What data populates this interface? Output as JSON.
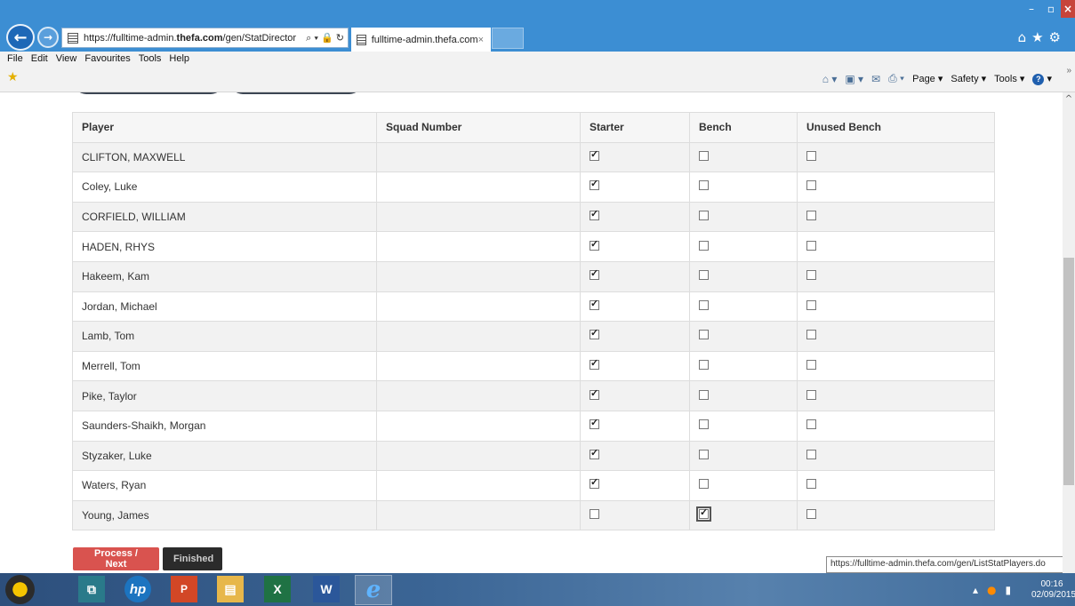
{
  "browser": {
    "address_url_prefix": "https://fulltime-admin.",
    "address_url_domain": "thefa.com",
    "address_url_suffix": "/gen/StatDirector",
    "address_icons": "⌕ ▾ 🔒 ↻",
    "tab_title": "fulltime-admin.thefa.com",
    "tab_close": "×",
    "window_controls": {
      "minimize": "–",
      "maximize": "▫",
      "close": "×"
    },
    "toolbar_icons": [
      "home-icon",
      "star-icon",
      "gear-icon"
    ]
  },
  "menubar": {
    "items": [
      "File",
      "Edit",
      "View",
      "Favourites",
      "Tools",
      "Help"
    ]
  },
  "commandbar": {
    "page_label": "Page ▾",
    "safety_label": "Safety ▾",
    "tools_label": "Tools ▾",
    "more": "»"
  },
  "table": {
    "headers": [
      "Player",
      "Squad Number",
      "Starter",
      "Bench",
      "Unused Bench"
    ],
    "rows": [
      {
        "player": "CLIFTON, MAXWELL",
        "squad": "",
        "starter": true,
        "bench": false,
        "unused": false
      },
      {
        "player": "Coley, Luke",
        "squad": "",
        "starter": true,
        "bench": false,
        "unused": false
      },
      {
        "player": "CORFIELD, WILLIAM",
        "squad": "",
        "starter": true,
        "bench": false,
        "unused": false
      },
      {
        "player": "HADEN, RHYS",
        "squad": "",
        "starter": true,
        "bench": false,
        "unused": false
      },
      {
        "player": "Hakeem, Kam",
        "squad": "",
        "starter": true,
        "bench": false,
        "unused": false
      },
      {
        "player": "Jordan, Michael",
        "squad": "",
        "starter": true,
        "bench": false,
        "unused": false
      },
      {
        "player": "Lamb, Tom",
        "squad": "",
        "starter": true,
        "bench": false,
        "unused": false
      },
      {
        "player": "Merrell, Tom",
        "squad": "",
        "starter": true,
        "bench": false,
        "unused": false
      },
      {
        "player": "Pike, Taylor",
        "squad": "",
        "starter": true,
        "bench": false,
        "unused": false
      },
      {
        "player": "Saunders-Shaikh, Morgan",
        "squad": "",
        "starter": true,
        "bench": false,
        "unused": false
      },
      {
        "player": "Styzaker, Luke",
        "squad": "",
        "starter": true,
        "bench": false,
        "unused": false
      },
      {
        "player": "Waters, Ryan",
        "squad": "",
        "starter": true,
        "bench": false,
        "unused": false
      },
      {
        "player": "Young, James",
        "squad": "",
        "starter": false,
        "bench": true,
        "unused": false
      }
    ]
  },
  "actions": {
    "process_label": "Process / Next",
    "finished_label": "Finished"
  },
  "status_tooltip": "https://fulltime-admin.thefa.com/gen/ListStatPlayers.do",
  "taskbar": {
    "apps": [
      "media-player-icon",
      "remote-desktop-icon",
      "hp-icon",
      "powerpoint-icon",
      "file-explorer-icon",
      "excel-icon",
      "word-icon",
      "internet-explorer-icon"
    ],
    "clock_time": "00:16",
    "clock_date": "02/09/2015"
  },
  "colors": {
    "browser_chrome": "#3c8ed3",
    "process_button": "#d9534f",
    "finished_button": "#2b2b2b"
  }
}
